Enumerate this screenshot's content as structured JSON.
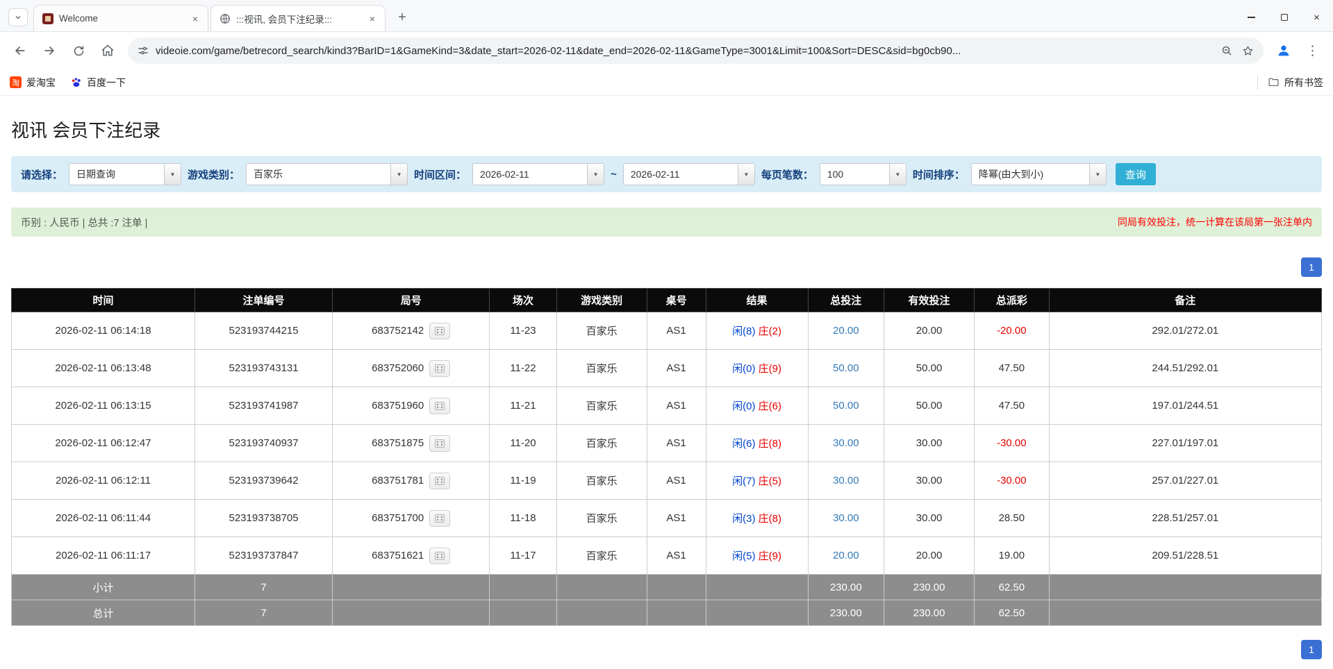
{
  "browser": {
    "tabs": [
      {
        "title": "Welcome"
      },
      {
        "title": ":::视讯, 会员下注纪录:::"
      }
    ],
    "url": "videoie.com/game/betrecord_search/kind3?BarID=1&GameKind=3&date_start=2026-02-11&date_end=2026-02-11&GameType=3001&Limit=100&Sort=DESC&sid=bg0cb90...",
    "bookmarks": {
      "taobao": "爱淘宝",
      "baidu": "百度一下",
      "all_bookmarks": "所有书签"
    }
  },
  "page": {
    "title": "视讯 会员下注纪录",
    "filters": {
      "select_label": "请选择：",
      "select_value": "日期查询",
      "game_label": "游戏类别：",
      "game_value": "百家乐",
      "range_label": "时间区间：",
      "date_start": "2026-02-11",
      "range_separator": "~",
      "date_end": "2026-02-11",
      "per_page_label": "每页笔数：",
      "per_page_value": "100",
      "sort_label": "时间排序：",
      "sort_value": "降幂(由大到小)",
      "search_button": "查询"
    },
    "info_bar": {
      "left": "币别 : 人民币 | 总共 :7 注单 |",
      "right": "同局有效投注，统一计算在该局第一张注单内"
    },
    "pagination": {
      "page": "1"
    },
    "table": {
      "headers": [
        "时间",
        "注单编号",
        "局号",
        "场次",
        "游戏类别",
        "桌号",
        "结果",
        "总投注",
        "有效投注",
        "总派彩",
        "备注"
      ],
      "rows": [
        {
          "time": "2026-02-11 06:14:18",
          "bet_id": "523193744215",
          "round": "683752142",
          "session": "11-23",
          "game": "百家乐",
          "table": "AS1",
          "player": "闲(8)",
          "banker": "庄(2)",
          "total_bet": "20.00",
          "valid_bet": "20.00",
          "payout": "-20.00",
          "note": "292.01/272.01"
        },
        {
          "time": "2026-02-11 06:13:48",
          "bet_id": "523193743131",
          "round": "683752060",
          "session": "11-22",
          "game": "百家乐",
          "table": "AS1",
          "player": "闲(0)",
          "banker": "庄(9)",
          "total_bet": "50.00",
          "valid_bet": "50.00",
          "payout": "47.50",
          "note": "244.51/292.01"
        },
        {
          "time": "2026-02-11 06:13:15",
          "bet_id": "523193741987",
          "round": "683751960",
          "session": "11-21",
          "game": "百家乐",
          "table": "AS1",
          "player": "闲(0)",
          "banker": "庄(6)",
          "total_bet": "50.00",
          "valid_bet": "50.00",
          "payout": "47.50",
          "note": "197.01/244.51"
        },
        {
          "time": "2026-02-11 06:12:47",
          "bet_id": "523193740937",
          "round": "683751875",
          "session": "11-20",
          "game": "百家乐",
          "table": "AS1",
          "player": "闲(6)",
          "banker": "庄(8)",
          "total_bet": "30.00",
          "valid_bet": "30.00",
          "payout": "-30.00",
          "note": "227.01/197.01"
        },
        {
          "time": "2026-02-11 06:12:11",
          "bet_id": "523193739642",
          "round": "683751781",
          "session": "11-19",
          "game": "百家乐",
          "table": "AS1",
          "player": "闲(7)",
          "banker": "庄(5)",
          "total_bet": "30.00",
          "valid_bet": "30.00",
          "payout": "-30.00",
          "note": "257.01/227.01"
        },
        {
          "time": "2026-02-11 06:11:44",
          "bet_id": "523193738705",
          "round": "683751700",
          "session": "11-18",
          "game": "百家乐",
          "table": "AS1",
          "player": "闲(3)",
          "banker": "庄(8)",
          "total_bet": "30.00",
          "valid_bet": "30.00",
          "payout": "28.50",
          "note": "228.51/257.01"
        },
        {
          "time": "2026-02-11 06:11:17",
          "bet_id": "523193737847",
          "round": "683751621",
          "session": "11-17",
          "game": "百家乐",
          "table": "AS1",
          "player": "闲(5)",
          "banker": "庄(9)",
          "total_bet": "20.00",
          "valid_bet": "20.00",
          "payout": "19.00",
          "note": "209.51/228.51"
        }
      ],
      "subtotal": {
        "label": "小计",
        "count": "7",
        "total_bet": "230.00",
        "valid_bet": "230.00",
        "payout": "62.50"
      },
      "grand_total": {
        "label": "总计",
        "count": "7",
        "total_bet": "230.00",
        "valid_bet": "230.00",
        "payout": "62.50"
      }
    },
    "colors": {
      "filter_bg": "#d9edf7",
      "info_bg": "#dff0d8",
      "search_button": "#31b0d5",
      "pagination_blue": "#3b6fd3",
      "bet_blue": "#337ab7",
      "player_blue": "#0044cc",
      "banker_red": "#e60000",
      "negative_red": "#e60000",
      "notice_red": "#ff0000"
    }
  }
}
